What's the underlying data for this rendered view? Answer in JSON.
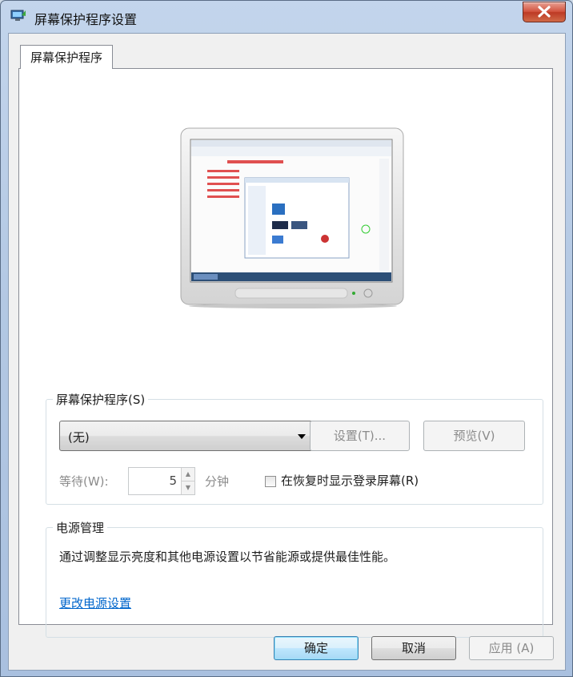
{
  "window": {
    "title": "屏幕保护程序设置"
  },
  "tabs": [
    {
      "label": "屏幕保护程序"
    }
  ],
  "screensaver_group": {
    "label": "屏幕保护程序(S)",
    "selected": "(无)",
    "settings_button": "设置(T)...",
    "preview_button": "预览(V)",
    "wait_label": "等待(W):",
    "wait_value": "5",
    "minutes_label": "分钟",
    "resume_checkbox_label": "在恢复时显示登录屏幕(R)",
    "resume_checked": false
  },
  "power_group": {
    "label": "电源管理",
    "description": "通过调整显示亮度和其他电源设置以节省能源或提供最佳性能。",
    "link": "更改电源设置"
  },
  "footer": {
    "ok": "确定",
    "cancel": "取消",
    "apply": "应用 (A)"
  },
  "colors": {
    "link": "#0066cc",
    "disabled_text": "#8b8b8b",
    "title_bar": "#b3c8e3"
  }
}
